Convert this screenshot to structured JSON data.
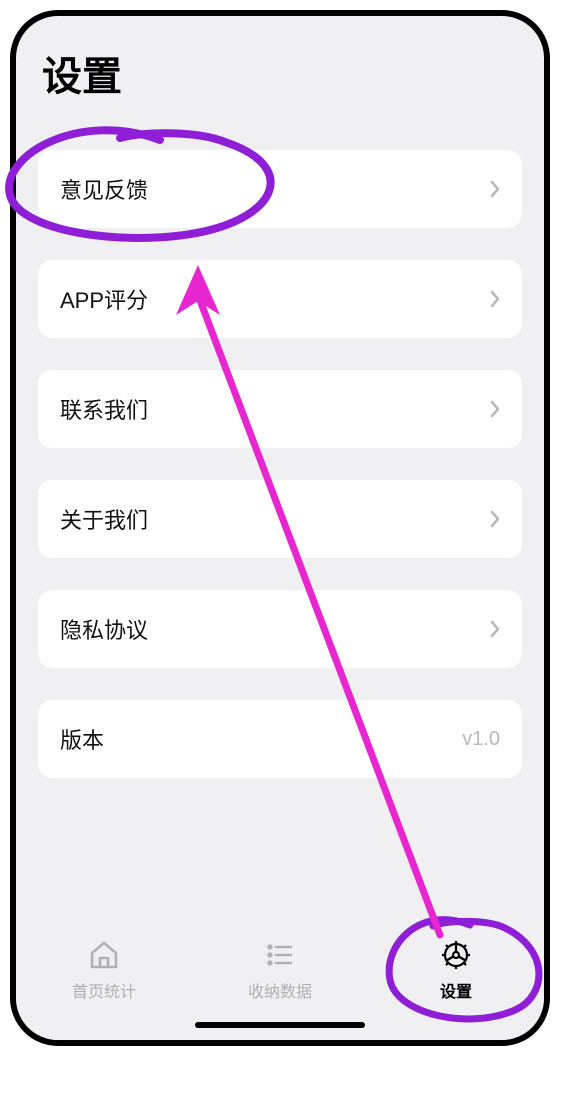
{
  "page": {
    "title": "设置"
  },
  "settings": {
    "items": [
      {
        "label": "意见反馈",
        "has_chevron": true
      },
      {
        "label": "APP评分",
        "has_chevron": true
      },
      {
        "label": "联系我们",
        "has_chevron": true
      },
      {
        "label": "关于我们",
        "has_chevron": true
      },
      {
        "label": "隐私协议",
        "has_chevron": true
      },
      {
        "label": "版本",
        "value": "v1.0",
        "has_chevron": false
      }
    ]
  },
  "tabbar": {
    "items": [
      {
        "label": "首页统计",
        "icon": "home-icon",
        "active": false
      },
      {
        "label": "收纳数据",
        "icon": "list-icon",
        "active": false
      },
      {
        "label": "设置",
        "icon": "gear-icon",
        "active": true
      }
    ]
  },
  "annotations": {
    "circle_color": "#8e1fd6",
    "arrow_color": "#e826d0"
  }
}
